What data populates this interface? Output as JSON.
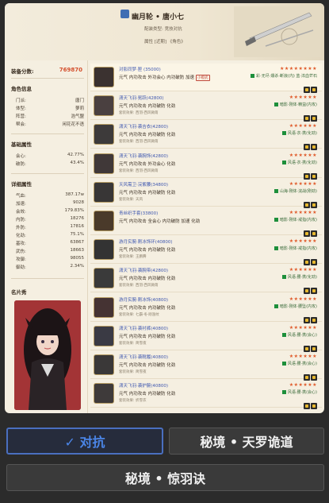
{
  "header": {
    "name": "幽月轮 • 唐小七",
    "line1": "配装类型: 竞技对抗",
    "line2": "属性 [近期] 《角色》"
  },
  "left": {
    "score_label": "装备分数:",
    "score_value": "769870",
    "role_title": "角色信息",
    "role": [
      {
        "k": "门派:",
        "v": "唐门"
      },
      {
        "k": "体型:",
        "v": "萝莉"
      },
      {
        "k": "阵营:",
        "v": "浩气盟"
      },
      {
        "k": "帮会:",
        "v": "闲花花不语"
      }
    ],
    "base_title": "基础属性",
    "base": [
      {
        "k": "会心:",
        "v": "42.77%"
      },
      {
        "k": "破防:",
        "v": "43.4%"
      }
    ],
    "detail_title": "详细属性",
    "detail": [
      {
        "k": "气血:",
        "v": "387.17w"
      },
      {
        "k": "加速:",
        "v": "9028"
      },
      {
        "k": "会效:",
        "v": "179.83%"
      },
      {
        "k": "内防:",
        "v": "18276"
      },
      {
        "k": "外防:",
        "v": "17816"
      },
      {
        "k": "化劲:",
        "v": "75.1%"
      },
      {
        "k": "基攻:",
        "v": "63867"
      },
      {
        "k": "武伤:",
        "v": "18663"
      },
      {
        "k": "攻御:",
        "v": "98055"
      },
      {
        "k": "御劲:",
        "v": "2.34%"
      }
    ],
    "portrait_title": "名片秀"
  },
  "items": [
    {
      "name": "对影同梦·匣 (35000)",
      "stats": "元气 内功攻击 外功会心 内功破防 加速",
      "badge": "小橙武",
      "sub": "",
      "stars": "★★★★★★★★",
      "tag": "彩·无尽·爆杀·断浪(内)  蓝·淬血芒石"
    },
    {
      "name": "潇天飞羽·冕跃(42800)",
      "stats": "元气 内功攻击 内功破防 化劲",
      "badge": "",
      "sub": "套装效果: 西羽·西风微雨",
      "stars": "★★★★★★",
      "tag": "暗影·刚体·精益(内攻)"
    },
    {
      "name": "潇天飞羽·袭吉衣(42800)",
      "stats": "元气 内功攻击 内功破防 化劲",
      "badge": "",
      "sub": "套装效果: 西羽·西风微雨",
      "stars": "★★★★★★",
      "tag": "风语·衣·携(化劲)"
    },
    {
      "name": "潇天飞羽·袭腕饰(42800)",
      "stats": "元气 内功攻击 外功会心 化劲",
      "badge": "",
      "sub": "套装效果: 西羽·西风微雨",
      "stars": "★★★★★★",
      "tag": "风语·衣·携(化劲)"
    },
    {
      "name": "天风需卫·浣紫腰(34800)",
      "stats": "元气 内功攻击 内功破防 化劲",
      "badge": "",
      "sub": "套装效果: 天风",
      "stars": "★★★★★★",
      "tag": "山海·刚体·浣战(刚劲)"
    },
    {
      "name": "青丝织手套(33800)",
      "stats": "元气 内功攻击 全会心 内功破防 加速 化劲",
      "badge": "",
      "sub": "",
      "stars": "★★★★★★",
      "tag": "暗影·刚体·戒指(内攻)"
    },
    {
      "name": "游月实腕·刚冰饰环(40800)",
      "stats": "元气 内功攻击 内功破防 化劲",
      "badge": "",
      "sub": "套装效果: 王鹏腾",
      "stars": "★★★★★★",
      "tag": "暗影·刚体·戒指(内攻)"
    },
    {
      "name": "潇天飞羽·袭腕带(42800)",
      "stats": "元气 内功攻击 内功破防 化劲",
      "badge": "",
      "sub": "套装效果: 西羽·西风微雨",
      "stars": "★★★★★★",
      "tag": "风语·腰·携(化劲)"
    },
    {
      "name": "游月实腕·刚冰饰(40800)",
      "stats": "元气 内功攻击 内功破防 化劲",
      "badge": "",
      "sub": "套装效果: 七霸·冬·刚涨纹",
      "stars": "★★★★★★",
      "tag": "暗影·刚体·腰坠(内攻)"
    },
    {
      "name": "潇天飞羽·袭衬裤(40800)",
      "stats": "元气 内功攻击 内功破防 化劲",
      "badge": "",
      "sub": "套装效果: 简雪夜",
      "stars": "★★★★★★",
      "tag": "风语·腰·携(会心)"
    },
    {
      "name": "潇天飞羽·袭靴履(40800)",
      "stats": "元气 内功攻击 内功破防 化劲",
      "badge": "",
      "sub": "套装效果: 简雪夜",
      "stars": "★★★★★★",
      "tag": "风语·腰·携(会心)"
    },
    {
      "name": "潇天飞羽·袭护腕(40800)",
      "stats": "元气 内功攻击 内功破防 化劲",
      "badge": "",
      "sub": "套装效果: 折雪衣",
      "stars": "★★★★★★",
      "tag": "风语·腰·携(会心)"
    }
  ],
  "buttons": {
    "selected": "✓ 对抗",
    "a": "秘境 • 天罗诡道",
    "b": "秘境 • 惊羽诀"
  },
  "colors": {
    "accent": "#4b86e8",
    "name_blue": "#3f58b0",
    "score_red": "#d4502e",
    "star": "#e05a2a"
  }
}
